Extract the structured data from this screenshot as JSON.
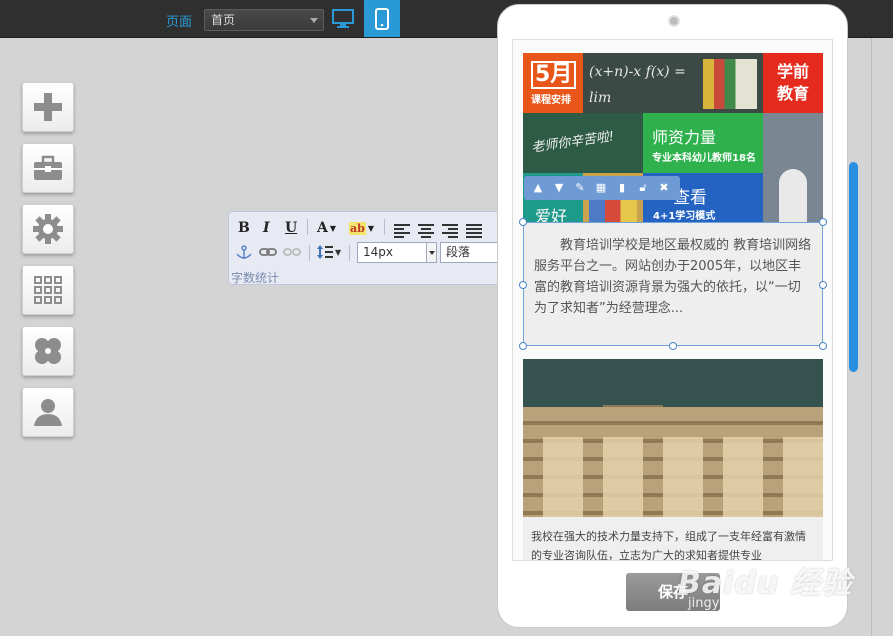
{
  "topbar": {
    "page_label": "页面",
    "page_select_value": "首页",
    "device_desktop_icon": "monitor-icon",
    "device_mobile_icon": "phone-icon",
    "accent": "#2a9ad6"
  },
  "tools": [
    {
      "name": "add-tool",
      "icon": "plus-icon"
    },
    {
      "name": "toolbox-tool",
      "icon": "toolbox-icon"
    },
    {
      "name": "settings-tool",
      "icon": "gear-icon"
    },
    {
      "name": "apps-tool",
      "icon": "grid-icon"
    },
    {
      "name": "modules-tool",
      "icon": "clover-icon"
    },
    {
      "name": "user-tool",
      "icon": "user-icon"
    }
  ],
  "editor": {
    "bold": "B",
    "italic": "I",
    "underline": "U",
    "font_color": "A",
    "highlight": "ab",
    "font_size": "14px",
    "paragraph": "段落",
    "word_count": "字数统计"
  },
  "banner": {
    "may_big": "5月",
    "may_small": "课程安排",
    "preschool": "学前\n教育",
    "teacher_title": "老师你辛苦啦!",
    "staff_title": "师资力量",
    "staff_sub": "专业本科幼儿教师18名",
    "hobby": "爱好",
    "view_title": "查看",
    "view_sub": "4+1学习模式",
    "chalk": "(x+n)-x f(x) = lim"
  },
  "content": {
    "paragraph": "教育培训学校是地区最权威的 教育培训网络服务平台之一。网站创办于2005年，以地区丰富的教育培训资源背景为强大的依托，以“一切为了求知者”为经营理念...",
    "photo_caption": "我校在强大的技术力量支持下，组成了一支年经富有激情的专业咨询队伍，立志为广大的求知者提供专业"
  },
  "save_label": "保存",
  "watermark": {
    "line1": "Baidu 经验",
    "line2": "jingyan.baidu.com"
  }
}
